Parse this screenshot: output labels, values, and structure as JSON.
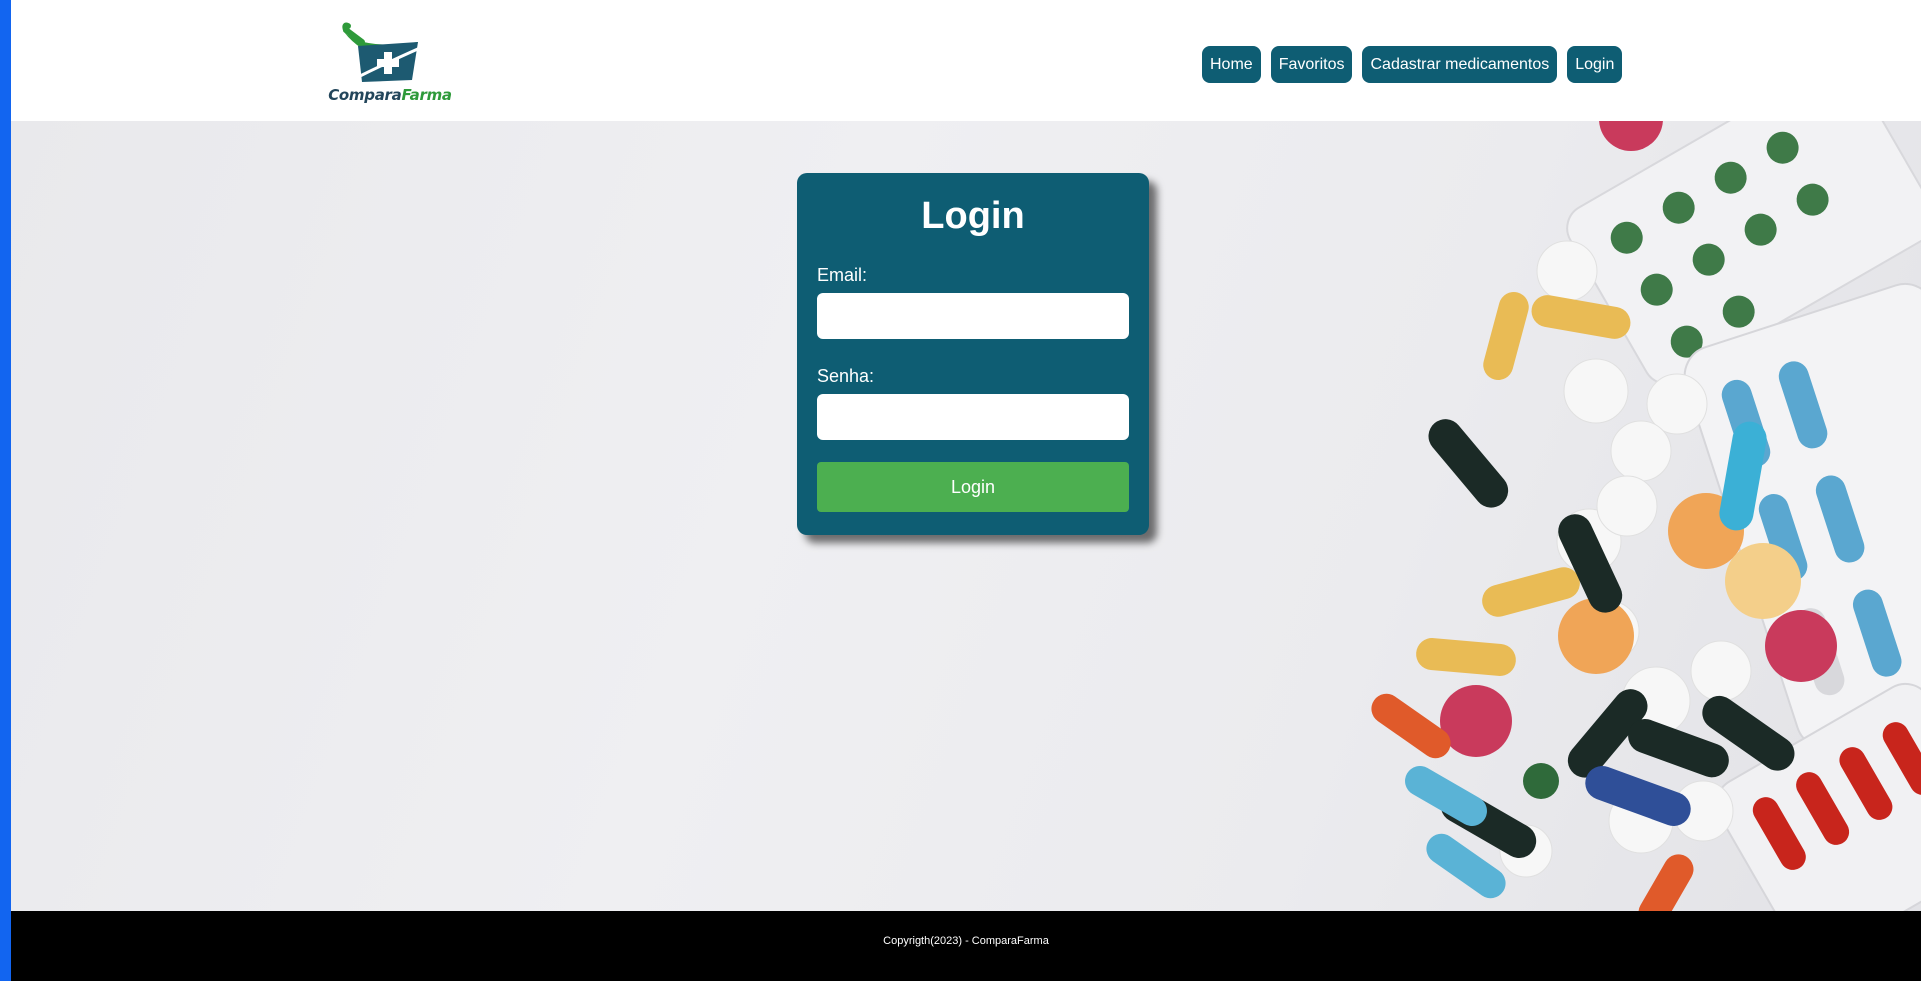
{
  "brand": {
    "name_part1": "Compara",
    "name_part2": "Farma",
    "colors": {
      "dark": "#23465b",
      "green": "#2e9a3a",
      "teal": "#0e5d73"
    }
  },
  "nav": {
    "items": [
      {
        "label": "Home"
      },
      {
        "label": "Favoritos"
      },
      {
        "label": "Cadastrar medicamentos"
      },
      {
        "label": "Login"
      }
    ]
  },
  "login_form": {
    "title": "Login",
    "email_label": "Email:",
    "email_value": "",
    "password_label": "Senha:",
    "password_value": "",
    "submit_label": "Login",
    "submit_color": "#4caf50"
  },
  "footer": {
    "copyright": "Copyrigth(2023) - ComparaFarma"
  },
  "icons": {
    "logo": "basket-with-medical-cross-icon",
    "background": "pills-photo"
  }
}
